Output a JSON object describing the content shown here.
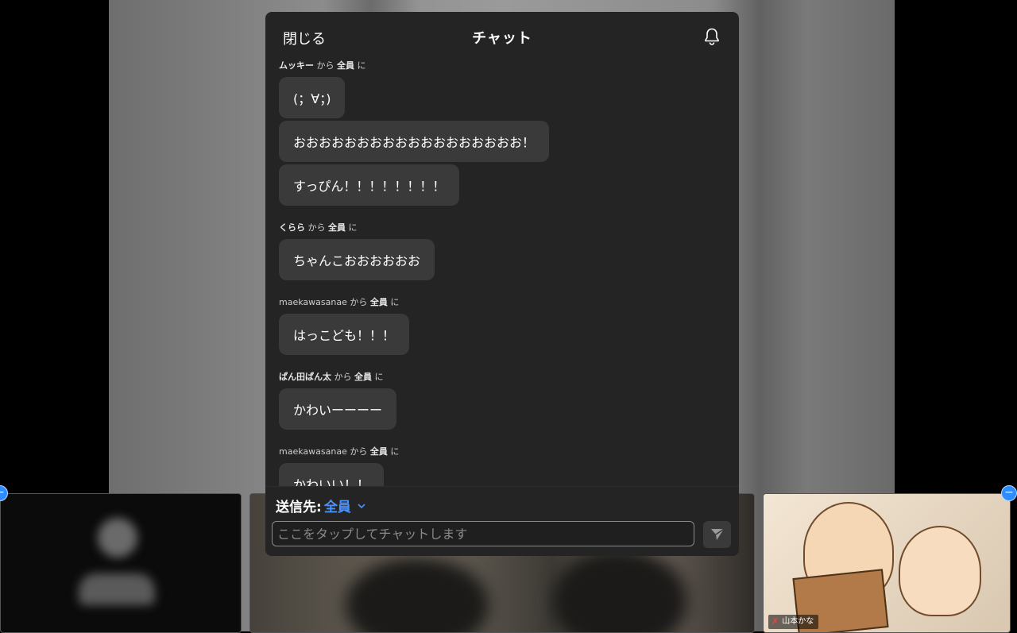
{
  "header": {
    "close_label": "閉じる",
    "title": "チャット"
  },
  "messages": [
    {
      "sender": "ムッキー",
      "from": "から",
      "to": "全員",
      "ni": "に",
      "texts": [
        "(；∀；)",
        "おおおおおおおおおおおおおおおおおお！",
        "すっぴん！！！！！！！！"
      ]
    },
    {
      "sender": "くらら",
      "from": "から",
      "to": "全員",
      "ni": "に",
      "texts": [
        "ちゃんこおおおおおお"
      ]
    },
    {
      "sender": "maekawasanae",
      "from": "から",
      "to": "全員",
      "ni": "に",
      "texts": [
        "はっこども！！！"
      ]
    },
    {
      "sender": "ぱん田ぱん太",
      "from": "から",
      "to": "全員",
      "ni": "に",
      "texts": [
        "かわいーーーー"
      ]
    },
    {
      "sender": "maekawasanae",
      "from": "から",
      "to": "全員",
      "ni": "に",
      "texts": [
        "かわいい！！"
      ]
    }
  ],
  "composer": {
    "to_label": "送信先:",
    "to_value": "全員",
    "placeholder": "ここをタップしてチャットします"
  },
  "participants": {
    "right_name": "山本かな"
  },
  "icons": {
    "bell": "bell-icon",
    "send": "send-icon",
    "chevron": "chevron-down-icon",
    "mic": "mic-muted-icon"
  },
  "colors": {
    "accent": "#4a93ff",
    "panel": "#242424",
    "bubble": "#3a3a3a"
  }
}
